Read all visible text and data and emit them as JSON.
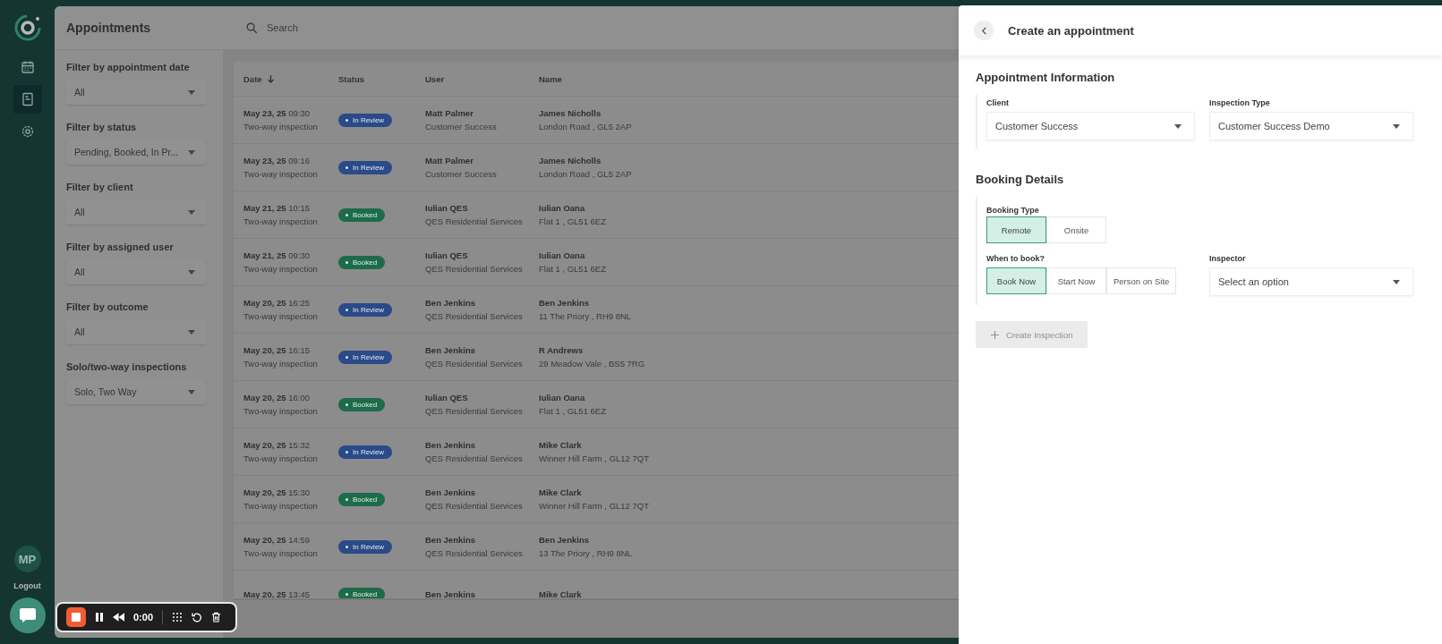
{
  "app": {
    "title": "Appointments",
    "search": {
      "placeholder": "Search"
    }
  },
  "nav": [
    {
      "kind": "calendar",
      "selected": false
    },
    {
      "kind": "document",
      "selected": true
    },
    {
      "kind": "settings",
      "selected": false
    }
  ],
  "user": {
    "initials": "MP",
    "logout": "Logout"
  },
  "filters": [
    {
      "label": "Filter by appointment date",
      "value": "All"
    },
    {
      "label": "Filter by status",
      "value": "Pending, Booked, In Pr..."
    },
    {
      "label": "Filter by client",
      "value": "All"
    },
    {
      "label": "Filter by assigned user",
      "value": "All"
    },
    {
      "label": "Filter by outcome",
      "value": "All"
    },
    {
      "label": "Solo/two-way inspections",
      "value": "Solo, Two Way"
    }
  ],
  "table": {
    "columns": [
      {
        "label": "Date",
        "sorted": true
      },
      {
        "label": "Status",
        "sorted": false
      },
      {
        "label": "User",
        "sorted": false
      },
      {
        "label": "Name",
        "sorted": false
      }
    ],
    "rows": [
      {
        "date": "May 23, 25",
        "time": "09:30",
        "type": "Two-way inspection",
        "status": {
          "label": "In Review",
          "kind": "review"
        },
        "user": "Matt Palmer",
        "org": "Customer Success",
        "name": "James Nicholls",
        "address": "London Road , GL5 2AP"
      },
      {
        "date": "May 23, 25",
        "time": "09:16",
        "type": "Two-way inspection",
        "status": {
          "label": "In Review",
          "kind": "review"
        },
        "user": "Matt Palmer",
        "org": "Customer Success",
        "name": "James Nicholls",
        "address": "London Road , GL5 2AP"
      },
      {
        "date": "May 21, 25",
        "time": "10:15",
        "type": "Two-way inspection",
        "status": {
          "label": "Booked",
          "kind": "booked"
        },
        "user": "Iulian QES",
        "org": "QES Residential Services",
        "name": "Iulian Oana",
        "address": "Flat 1 , GL51 6EZ"
      },
      {
        "date": "May 21, 25",
        "time": "09:30",
        "type": "Two-way inspection",
        "status": {
          "label": "Booked",
          "kind": "booked"
        },
        "user": "Iulian QES",
        "org": "QES Residential Services",
        "name": "Iulian Oana",
        "address": "Flat 1 , GL51 6EZ"
      },
      {
        "date": "May 20, 25",
        "time": "16:25",
        "type": "Two-way inspection",
        "status": {
          "label": "In Review",
          "kind": "review"
        },
        "user": "Ben Jenkins",
        "org": "QES Residential Services",
        "name": "Ben Jenkins",
        "address": "11 The Priory , RH9 8NL"
      },
      {
        "date": "May 20, 25",
        "time": "16:15",
        "type": "Two-way inspection",
        "status": {
          "label": "In Review",
          "kind": "review"
        },
        "user": "Ben Jenkins",
        "org": "QES Residential Services",
        "name": "R Andrews",
        "address": "29 Meadow Vale , BS5 7RG"
      },
      {
        "date": "May 20, 25",
        "time": "16:00",
        "type": "Two-way inspection",
        "status": {
          "label": "Booked",
          "kind": "booked"
        },
        "user": "Iulian QES",
        "org": "QES Residential Services",
        "name": "Iulian Oana",
        "address": "Flat 1 , GL51 6EZ"
      },
      {
        "date": "May 20, 25",
        "time": "15:32",
        "type": "Two-way inspection",
        "status": {
          "label": "In Review",
          "kind": "review"
        },
        "user": "Ben Jenkins",
        "org": "QES Residential Services",
        "name": "Mike Clark",
        "address": "Winner Hill Farm , GL12 7QT"
      },
      {
        "date": "May 20, 25",
        "time": "15:30",
        "type": "Two-way inspection",
        "status": {
          "label": "Booked",
          "kind": "booked"
        },
        "user": "Ben Jenkins",
        "org": "QES Residential Services",
        "name": "Mike Clark",
        "address": "Winner Hill Farm , GL12 7QT"
      },
      {
        "date": "May 20, 25",
        "time": "14:59",
        "type": "Two-way inspection",
        "status": {
          "label": "In Review",
          "kind": "review"
        },
        "user": "Ben Jenkins",
        "org": "QES Residential Services",
        "name": "Ben Jenkins",
        "address": "13 The Priory , RH9 8NL"
      },
      {
        "date": "May 20, 25",
        "time": "13:45",
        "status": {
          "label": "Booked",
          "kind": "booked"
        },
        "user": "Ben Jenkins",
        "name": "Mike Clark"
      }
    ]
  },
  "drawer": {
    "title": "Create an appointment",
    "appointment_info": {
      "heading": "Appointment Information",
      "client": {
        "label": "Client",
        "value": "Customer Success"
      },
      "inspection_type": {
        "label": "Inspection Type",
        "value": "Customer Success Demo"
      }
    },
    "booking": {
      "heading": "Booking Details",
      "booking_type": {
        "label": "Booking Type",
        "options": [
          {
            "label": "Remote",
            "selected": true
          },
          {
            "label": "Onsite",
            "selected": false
          }
        ]
      },
      "when": {
        "label": "When to book?",
        "options": [
          {
            "label": "Book Now",
            "selected": true
          },
          {
            "label": "Start Now",
            "selected": false
          },
          {
            "label": "Person on Site",
            "selected": false
          }
        ]
      },
      "inspector": {
        "label": "Inspector",
        "placeholder": "Select an option"
      }
    },
    "create_button": {
      "label": "Create Inspection",
      "disabled": true
    }
  },
  "recorder": {
    "time": "0:00"
  }
}
